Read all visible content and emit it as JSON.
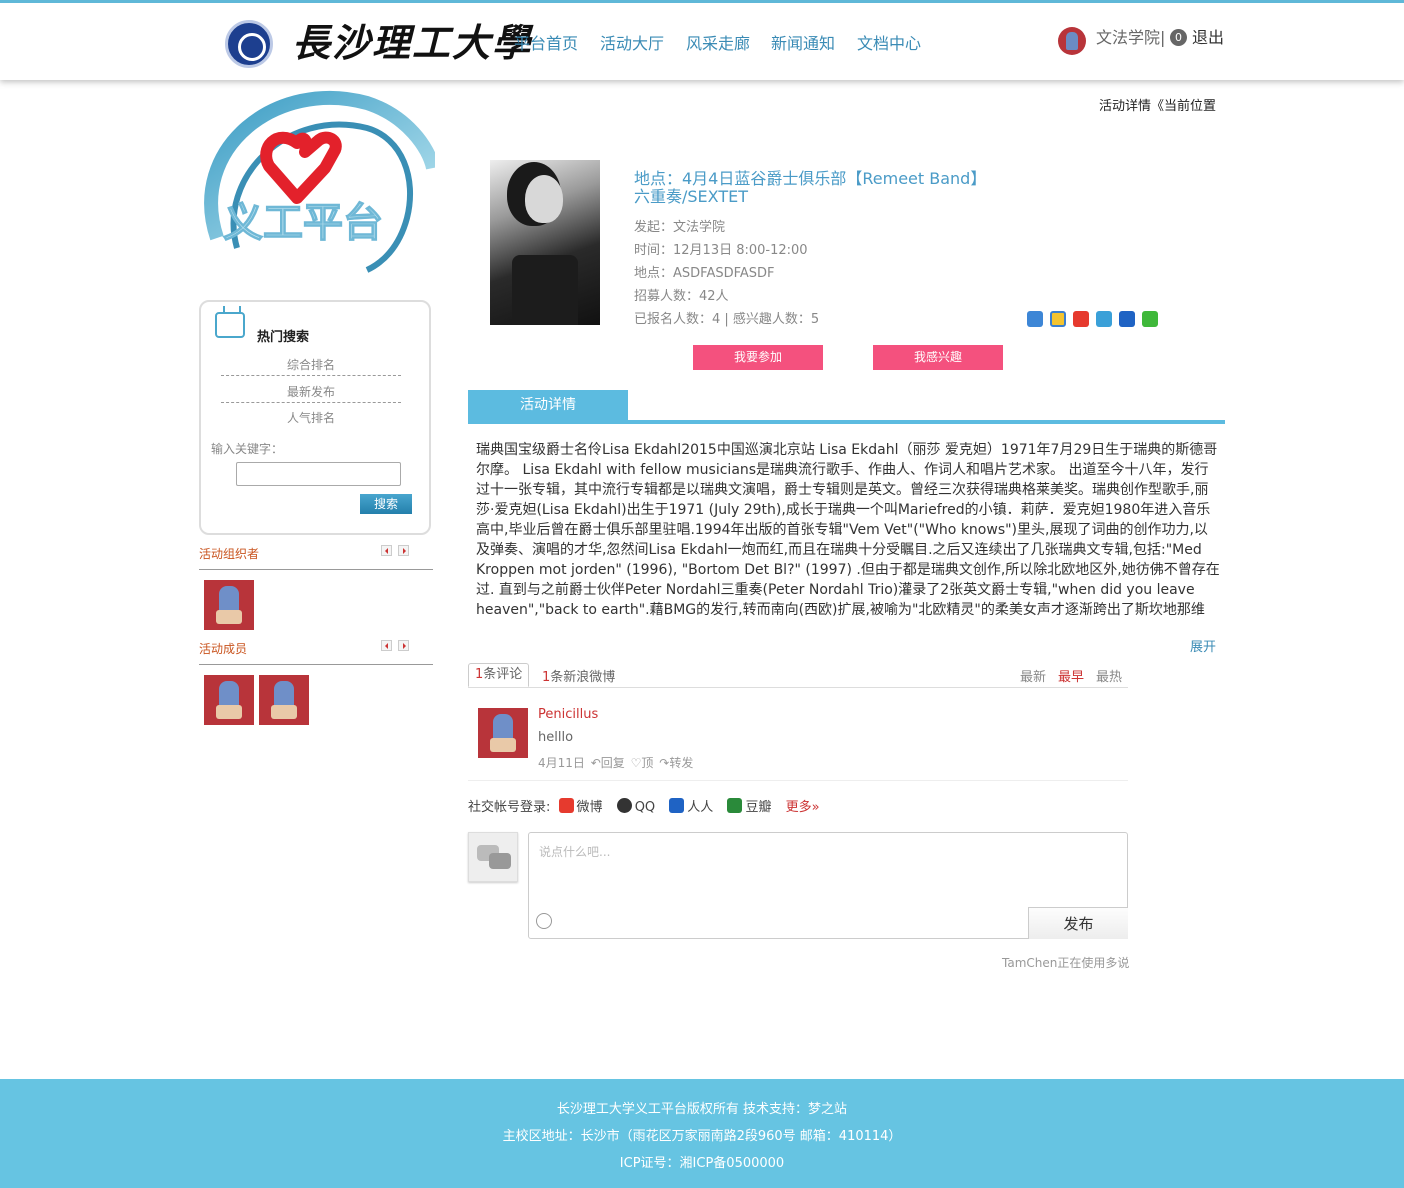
{
  "header": {
    "school_name": "長沙理工大學",
    "nav": [
      "平台首页",
      "活动大厅",
      "风采走廊",
      "新闻通知",
      "文档中心"
    ],
    "user_name": "文法学院|",
    "message_count": "0",
    "logout": "退出"
  },
  "breadcrumb": "活动详情《当前位置",
  "platform_logo_text": "义工平台",
  "sidebar": {
    "hot_search_title": "热门搜索",
    "rankings": [
      "综合排名",
      "最新发布",
      "人气排名"
    ],
    "keyword_label": "输入关键字：",
    "search_button": "搜索",
    "organizers_title": "活动组织者",
    "members_title": "活动成员"
  },
  "activity": {
    "title": "地点：4月4日蓝谷爵士俱乐部【Remeet Band】六重奏/SEXTET",
    "initiator": "发起：文法学院",
    "time": "时间：12月13日 8:00-12:00",
    "location": "地点：ASDFASDFASDF",
    "recruit": "招募人数：42人",
    "signup": "已报名人数：4 | 感兴趣人数：5",
    "join_button": "我要参加",
    "interest_button": "我感兴趣",
    "tab": "活动详情",
    "detail": " 瑞典国宝级爵士名伶Lisa Ekdahl2015中国巡演北京站 Lisa Ekdahl（丽莎 爱克妲）1971年7月29日生于瑞典的斯德哥尔摩。 Lisa Ekdahl with fellow musicians是瑞典流行歌手、作曲人、作词人和唱片艺术家。 出道至今十八年，发行过十一张专辑，其中流行专辑都是以瑞典文演唱，爵士专辑则是英文。曾经三次获得瑞典格莱美奖。瑞典创作型歌手,丽莎·爱克妲(Lisa Ekdahl)出生于1971 (July 29th),成长于瑞典一个叫Mariefred的小镇．莉萨．爱克妲1980年进入音乐高中,毕业后曾在爵士俱乐部里驻唱.1994年出版的首张专辑\"Vem Vet\"(\"Who knows\")里头,展现了词曲的创作功力,以及弹奏、演唱的才华,忽然间Lisa Ekdahl一炮而红,而且在瑞典十分受瞩目.之后又连续出了几张瑞典文专辑,包括:\"Med Kroppen mot jorden\" (1996), \"Bortom Det Bl?\" (1997) .但由于都是瑞典文创作,所以除北欧地区外,她彷佛不曾存在过. 直到与之前爵士伙伴Peter Nordahl三重奏(Peter Nordahl Trio)灌录了2张英文爵士专辑,\"when did you leave heaven\",\"back to earth\".藉BMG的发行,转而南向(西欧)扩展,被喻为\"北欧精灵\"的柔美女声才逐渐跨出了斯坎地那维亚,且在法国爵士乐界受",
    "expand": "展开"
  },
  "comments": {
    "count_num": "1",
    "count_label": "条评论",
    "weibo_num": "1",
    "weibo_label": "条新浪微博",
    "sort": [
      "最新",
      "最早",
      "最热"
    ],
    "items": [
      {
        "author": "Penicillus",
        "text": "helllo",
        "date": "4月11日",
        "reply": "回复",
        "like": "顶",
        "share": "转发"
      }
    ],
    "social_label": "社交帐号登录:",
    "social": [
      "微博",
      "QQ",
      "人人",
      "豆瓣"
    ],
    "more": "更多»",
    "placeholder": "说点什么吧...",
    "publish": "发布",
    "powered": "TamChen正在使用多说"
  },
  "footer": {
    "line1": "长沙理工大学义工平台版权所有  技术支持：梦之站",
    "line2": "主校区地址：长沙市（雨花区万家丽南路2段960号 邮箱：410114）",
    "line3": "ICP证号：湘ICP备0500000"
  },
  "colors": {
    "accent": "#5cbbe0",
    "button_pink": "#f4517e",
    "link_blue": "#3a8bb5",
    "footer": "#66c4e2"
  }
}
